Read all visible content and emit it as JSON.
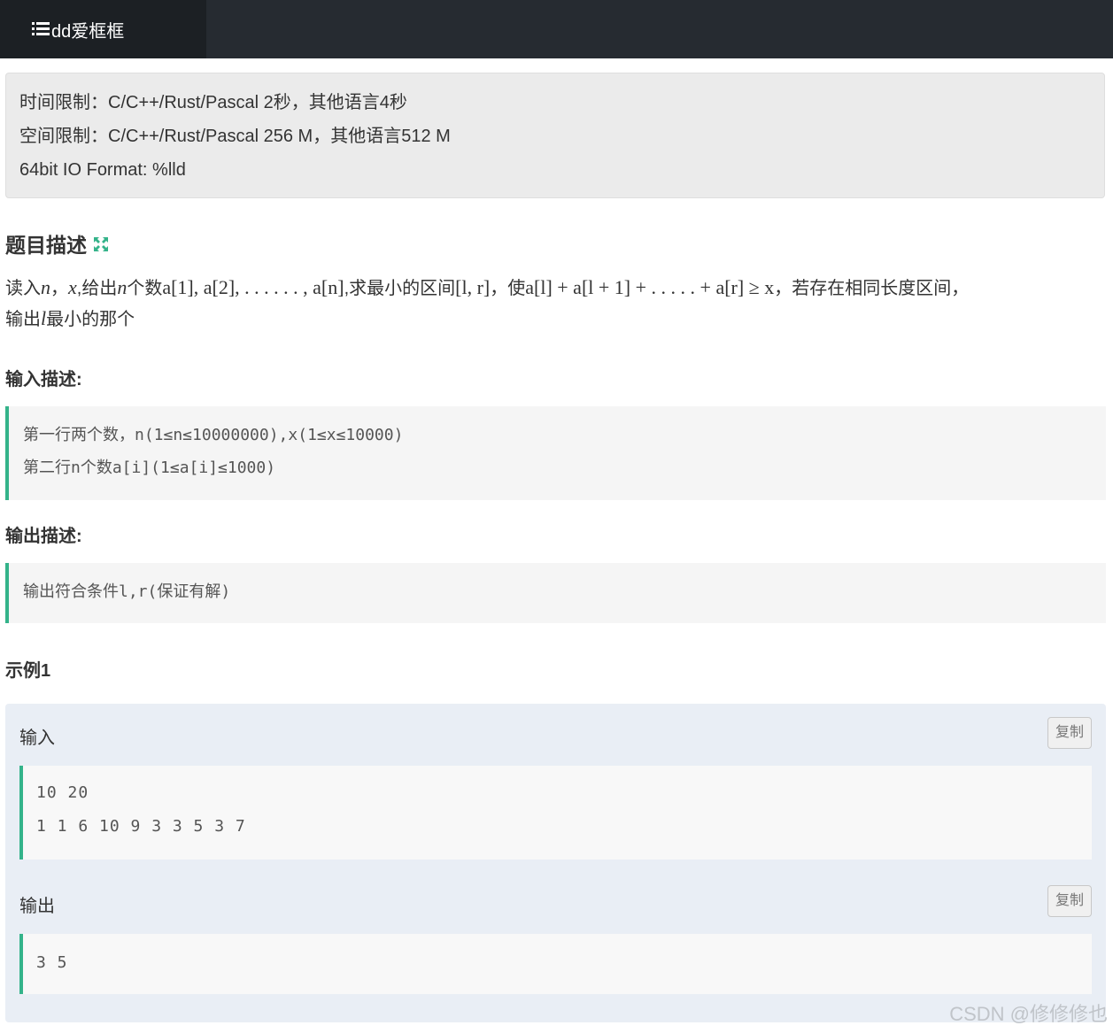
{
  "header": {
    "brand_label": "dd爱框框"
  },
  "limits": {
    "time": "时间限制：C/C++/Rust/Pascal 2秒，其他语言4秒",
    "space": "空间限制：C/C++/Rust/Pascal 256 M，其他语言512 M",
    "format": "64bit IO Format: %lld"
  },
  "description": {
    "title": "题目描述",
    "p1": "读入",
    "n": "n",
    "comma1": "，",
    "x": "x",
    "p2": ",给出",
    "p3": "个数",
    "seq": "a[1], a[2], . . . . . . , a[n]",
    "p4": ",求最小的区间",
    "interval": "[l, r]",
    "p5": "，使",
    "ineq": "a[l] + a[l + 1] + . . . . . + a[r] ≥ x",
    "p6": "，若存在相同长度区间，",
    "p7": "输出",
    "l": "l",
    "p8": "最小的那个"
  },
  "input_desc": {
    "title": "输入描述:",
    "lines": [
      "第一行两个数，n(1≤n≤10000000),x(1≤x≤10000)",
      "第二行n个数a[i](1≤a[i]≤1000)"
    ]
  },
  "output_desc": {
    "title": "输出描述:",
    "lines": [
      "输出符合条件l,r(保证有解)"
    ]
  },
  "example": {
    "title": "示例1",
    "input_label": "输入",
    "output_label": "输出",
    "copy_label": "复制",
    "input_lines": [
      "10 20",
      "1 1 6 10 9 3 3 5 3 7"
    ],
    "output_lines": [
      "3 5"
    ]
  },
  "watermark": "CSDN @修修修也"
}
